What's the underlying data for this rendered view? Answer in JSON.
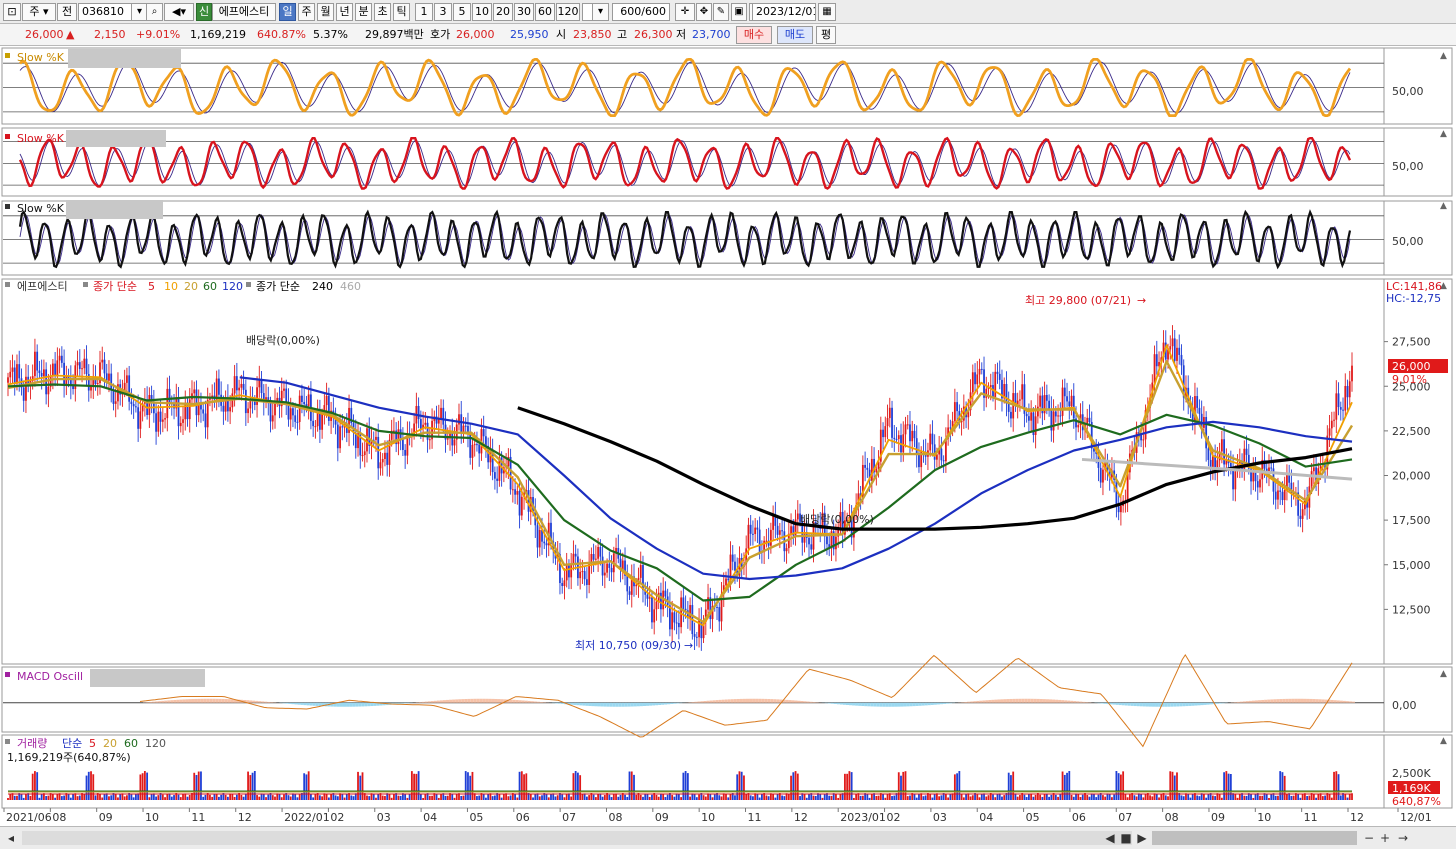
{
  "toolbar": {
    "period_type": "주",
    "prev_label": "전",
    "stock_code": "036810",
    "credit_badge": "신",
    "stock_name": "에프에스티",
    "periods": [
      "일",
      "주",
      "월",
      "년",
      "분",
      "초",
      "틱"
    ],
    "selected_period": "일",
    "intervals": [
      "1",
      "3",
      "5",
      "10",
      "20",
      "30",
      "60",
      "120"
    ],
    "count": "600/600",
    "date": "2023/12/01"
  },
  "quote": {
    "price": "26,000",
    "change": "2,150",
    "change_pct": "+9.01%",
    "volume": "1,169,219",
    "volume_pct": "640.87%",
    "turnover": "5.37%",
    "trade_value": "29,897백만",
    "bid_label": "호가",
    "ask": "26,000",
    "bid": "25,950",
    "open_label": "시",
    "open": "23,850",
    "high_label": "고",
    "high": "26,300",
    "low_label": "저",
    "low": "23,700",
    "buy_label": "매수",
    "sell_label": "매도",
    "avg_label": "평"
  },
  "colors": {
    "up": "#e01a1a",
    "down": "#1f3fd6",
    "ma5": "#e01a1a",
    "ma10": "#f0a000",
    "ma20": "#c8a030",
    "ma60": "#1e6b1e",
    "ma120": "#1c2fc0",
    "ma240": "#000000",
    "ma460": "#bbbbbb",
    "stoch1": "#f0a020",
    "stoch2": "#d8141e",
    "stoch3": "#111111"
  },
  "panels": {
    "stoch1": {
      "title": "Slow %K",
      "level": "50,00"
    },
    "stoch2": {
      "title": "Slow %K",
      "level": "50,00"
    },
    "stoch3": {
      "title": "Slow %K",
      "level": "50,00"
    },
    "price": {
      "title": "에프에스티",
      "ma_label": "종가 단순",
      "ma_periods": [
        "5",
        "10",
        "20",
        "60",
        "120"
      ],
      "ma_long_label": "종가 단순",
      "ma_long_periods": [
        "240",
        "460"
      ],
      "lc": "LC:141,86",
      "hc": "HC:-12,75",
      "price_tag": "26,000",
      "pct_tag": "9,01%",
      "high_annotation": "최고 29,800 (07/21)",
      "low_annotation": "최저 10,750 (09/30)",
      "dividend1": "배당락(0,00%)",
      "dividend2": "배당락(0,00%)",
      "y_ticks": [
        "27,500",
        "25,000",
        "22,500",
        "20,000",
        "17,500",
        "15,000",
        "12,500"
      ]
    },
    "macd": {
      "title": "MACD Oscill",
      "level": "0,00"
    },
    "volume": {
      "title": "거래량",
      "ma_label": "단순",
      "ma_periods": [
        "5",
        "20",
        "60",
        "120"
      ],
      "current": "1,169,219주(640,87%)",
      "level": "2,500K",
      "tag": "1,169K",
      "pct_tag": "640,87%"
    }
  },
  "x_axis": [
    "2021/06",
    "08",
    "09",
    "10",
    "11",
    "12",
    "2022/01",
    "02",
    "03",
    "04",
    "05",
    "06",
    "07",
    "08",
    "09",
    "10",
    "11",
    "12",
    "2023/01",
    "02",
    "03",
    "04",
    "05",
    "06",
    "07",
    "08",
    "09",
    "10",
    "11",
    "12",
    "12/01"
  ],
  "chart_data": {
    "type": "line",
    "title": "에프에스티",
    "x": [
      "2021/06",
      "08",
      "09",
      "10",
      "11",
      "12",
      "2022/01",
      "02",
      "03",
      "04",
      "05",
      "06",
      "07",
      "08",
      "09",
      "10",
      "11",
      "12",
      "2023/01",
      "02",
      "03",
      "04",
      "05",
      "06",
      "07",
      "08",
      "09",
      "10",
      "11",
      "12"
    ],
    "ylim": [
      10000,
      30000
    ],
    "series": [
      {
        "name": "5",
        "values": [
          25200,
          25800,
          25600,
          23500,
          23800,
          24600,
          23900,
          23200,
          21200,
          23000,
          22200,
          19200,
          14500,
          15300,
          12800,
          11500,
          16400,
          16900,
          16700,
          22800,
          21000,
          25600,
          23500,
          23900,
          18400,
          27900,
          20900,
          20200,
          18300,
          26000
        ]
      },
      {
        "name": "10",
        "values": [
          25100,
          25600,
          25500,
          23800,
          23900,
          24500,
          24000,
          23300,
          21400,
          22700,
          22300,
          19500,
          14700,
          15200,
          13000,
          11600,
          15900,
          16800,
          16700,
          22000,
          21100,
          25200,
          23600,
          23800,
          18800,
          27300,
          21100,
          20300,
          18400,
          24100
        ]
      },
      {
        "name": "20",
        "values": [
          24900,
          25400,
          25400,
          24100,
          24000,
          24300,
          24000,
          23400,
          21700,
          22400,
          22400,
          19900,
          15000,
          15200,
          13300,
          11800,
          15400,
          16600,
          16700,
          21200,
          21200,
          24600,
          23700,
          23700,
          19400,
          26400,
          21400,
          20400,
          18600,
          22800
        ]
      },
      {
        "name": "60",
        "values": [
          25000,
          25100,
          25000,
          24200,
          24400,
          24300,
          24100,
          23500,
          22500,
          22200,
          22100,
          20600,
          17500,
          15800,
          14800,
          13000,
          13200,
          15000,
          16300,
          18200,
          20300,
          21600,
          22400,
          23100,
          22300,
          23400,
          22800,
          21800,
          20500,
          20900
        ]
      },
      {
        "name": "120",
        "values": [
          null,
          null,
          null,
          null,
          null,
          25500,
          25200,
          24500,
          23800,
          23300,
          22900,
          22300,
          20000,
          17600,
          15900,
          14500,
          14200,
          14400,
          14800,
          15900,
          17300,
          19000,
          20300,
          21400,
          22000,
          22700,
          23000,
          22700,
          22200,
          21900
        ]
      },
      {
        "name": "240",
        "values": [
          null,
          null,
          null,
          null,
          null,
          null,
          null,
          null,
          null,
          null,
          null,
          23800,
          22900,
          21900,
          20800,
          19500,
          18300,
          17300,
          17000,
          17000,
          17000,
          17100,
          17300,
          17600,
          18400,
          19500,
          20200,
          20700,
          21000,
          21500
        ]
      }
    ],
    "annotations": [
      {
        "label": "최고 29,800 (07/21)",
        "x": "07",
        "y": 29800
      },
      {
        "label": "최저 10,750 (09/30)",
        "x": "09",
        "y": 10750
      }
    ]
  }
}
